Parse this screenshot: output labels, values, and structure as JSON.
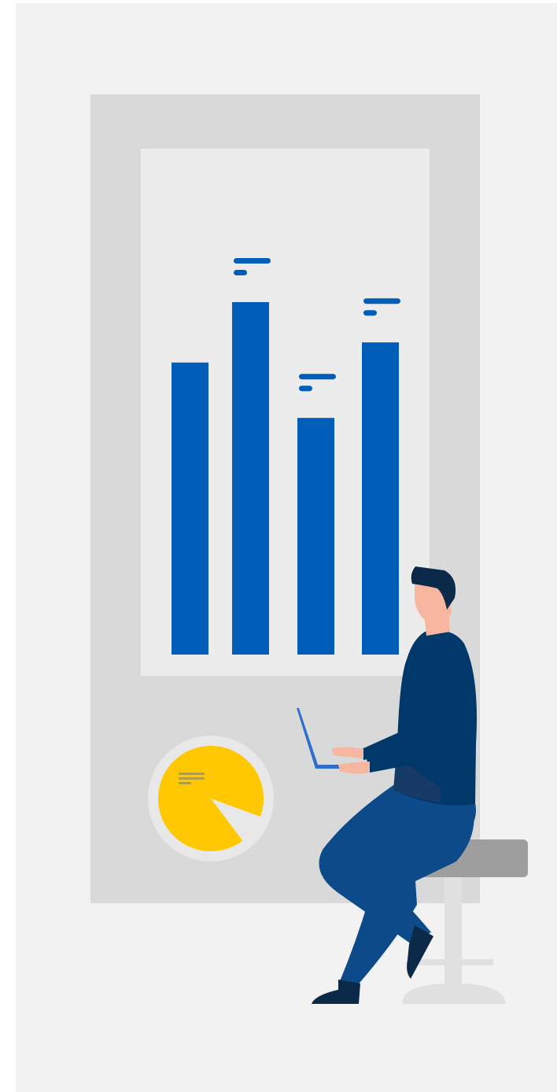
{
  "colors": {
    "page_background": "#ffffff",
    "backdrop": "#f2f2f2",
    "board": "#d9d9d9",
    "screen": "#ececec",
    "bar": "#005eb8",
    "pie_ring": "#e8e8e8",
    "pie": "#ffc800",
    "pie_lines": "#b59a45",
    "stool_seat": "#9e9e9e",
    "stool_leg": "#e0e0e0",
    "hair": "#0b2a4a",
    "skin": "#f7b6a0",
    "sweater": "#01386a",
    "sweater_shadow": "#173a66",
    "pants": "#0c4a8a",
    "shoe": "#0b2a4a",
    "laptop": "#2f6fc9"
  },
  "chart_data": {
    "type": "bar",
    "categories": [
      "",
      "",
      "",
      ""
    ],
    "values": [
      58,
      70,
      47,
      62
    ],
    "ylim": [
      0,
      100
    ],
    "grid": false,
    "legend": "none"
  },
  "icons": {
    "pie": "pie-chart-icon",
    "person": "person-with-laptop",
    "stool": "stool-icon"
  }
}
